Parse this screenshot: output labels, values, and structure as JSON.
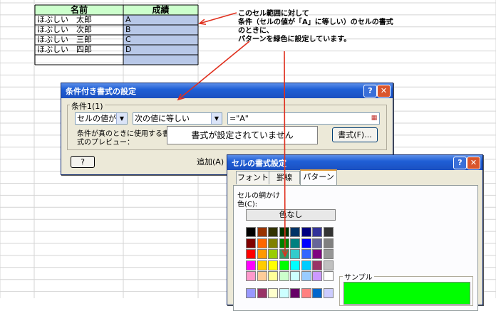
{
  "sheet": {
    "headers": [
      "名前",
      "成績"
    ],
    "rows": [
      {
        "name": "ほぶしい　太郎",
        "grade": "A"
      },
      {
        "name": "ほぶしい　次郎",
        "grade": "B"
      },
      {
        "name": "ほぶしい　三郎",
        "grade": "C"
      },
      {
        "name": "ほぶしい　四郎",
        "grade": "D"
      },
      {
        "name": "",
        "grade": ""
      }
    ],
    "grade_fill": "#b8c8e8",
    "header_fill": "#ccffcc"
  },
  "callout": {
    "lines": [
      "このセル範囲に対して",
      "条件（セルの値が「A」に等しい）のセルの書式",
      "のときに、",
      "パターンを緑色に設定しています。"
    ],
    "arrow_color": "#e0301e"
  },
  "cond_dialog": {
    "title": "条件付き書式の設定",
    "group_label": "条件1(1)",
    "type_value": "セルの値が",
    "operator_value": "次の値に等しい",
    "formula_value": "=\"A\"",
    "preview_label_1": "条件が真のときに使用する書",
    "preview_label_2": "式のプレビュー：",
    "preview_text": "書式が設定されていません",
    "format_button": "書式(F)...",
    "help_button": "?",
    "add_button": "追加(A)"
  },
  "format_dialog": {
    "title": "セルの書式設定",
    "tabs": [
      "フォント",
      "罫線",
      "パターン"
    ],
    "active_tab": "パターン",
    "shading_label": "セルの網かけ",
    "color_label": "色(C):",
    "no_color_label": "色なし",
    "sample_label": "サンプル",
    "sample_color": "#00ff00",
    "palette": [
      [
        "#000000",
        "#993300",
        "#333300",
        "#003300",
        "#003366",
        "#000080",
        "#333399",
        "#333333"
      ],
      [
        "#800000",
        "#ff6600",
        "#808000",
        "#008000",
        "#008080",
        "#0000ff",
        "#666699",
        "#808080"
      ],
      [
        "#ff0000",
        "#ff9900",
        "#99cc00",
        "#339966",
        "#33cccc",
        "#3366ff",
        "#800080",
        "#969696"
      ],
      [
        "#ff00ff",
        "#ffcc00",
        "#ffff00",
        "#00ff00",
        "#00ffff",
        "#00ccff",
        "#993366",
        "#c0c0c0"
      ],
      [
        "#ff99cc",
        "#ffcc99",
        "#ffff99",
        "#ccffcc",
        "#ccffff",
        "#99ccff",
        "#cc99ff",
        "#ffffff"
      ],
      [
        "#9999ff",
        "#993366",
        "#ffffcc",
        "#ccffff",
        "#660066",
        "#ff8080",
        "#0066cc",
        "#ccccff"
      ]
    ]
  }
}
